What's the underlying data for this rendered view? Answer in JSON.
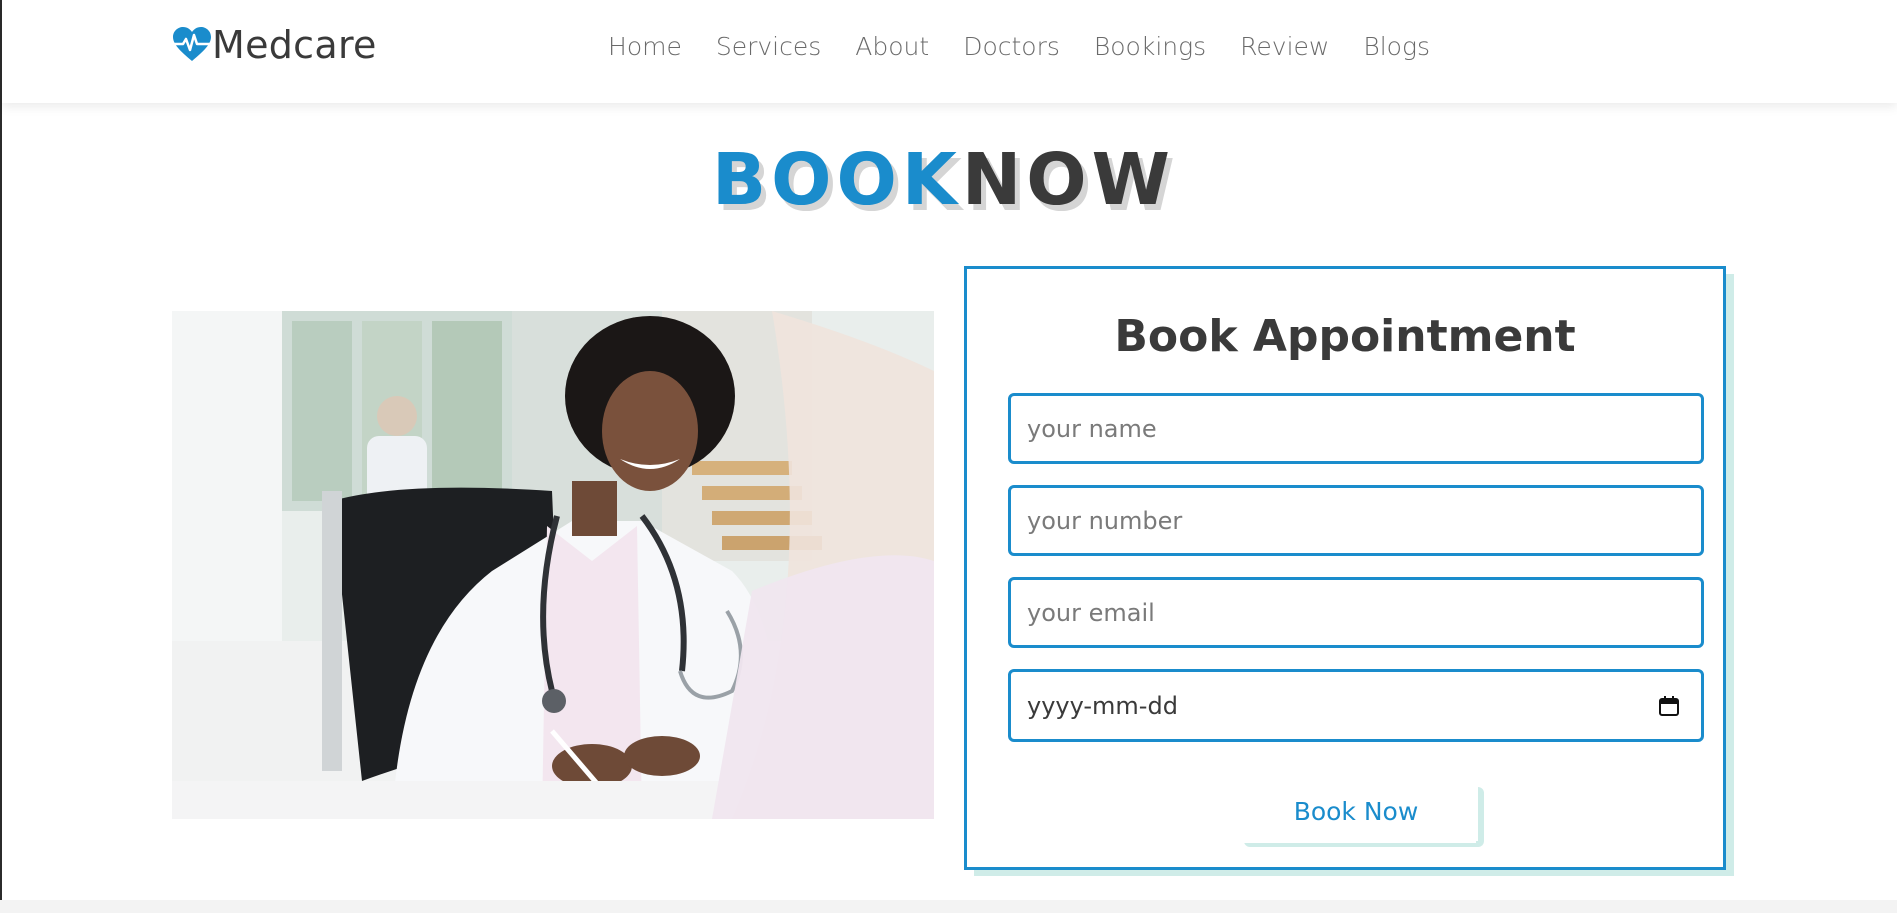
{
  "brand": {
    "name": "Medcare",
    "logo_icon": "heart-pulse-icon",
    "accent": "#1a8ccc"
  },
  "nav": {
    "items": [
      {
        "label": "Home"
      },
      {
        "label": "Services"
      },
      {
        "label": "About"
      },
      {
        "label": "Doctors"
      },
      {
        "label": "Bookings"
      },
      {
        "label": "Review"
      },
      {
        "label": "Blogs"
      }
    ]
  },
  "section": {
    "heading_part1": "BOOK",
    "heading_part2": "NOW"
  },
  "form": {
    "title": "Book Appointment",
    "name_placeholder": "your name",
    "number_placeholder": "your number",
    "email_placeholder": "your email",
    "date_placeholder": "yyyy-mm-dd",
    "submit_label": "Book Now"
  },
  "colors": {
    "accent": "#1a8ccc",
    "text_dark": "#3a3a3a",
    "shadow_mint": "#cfece8"
  }
}
